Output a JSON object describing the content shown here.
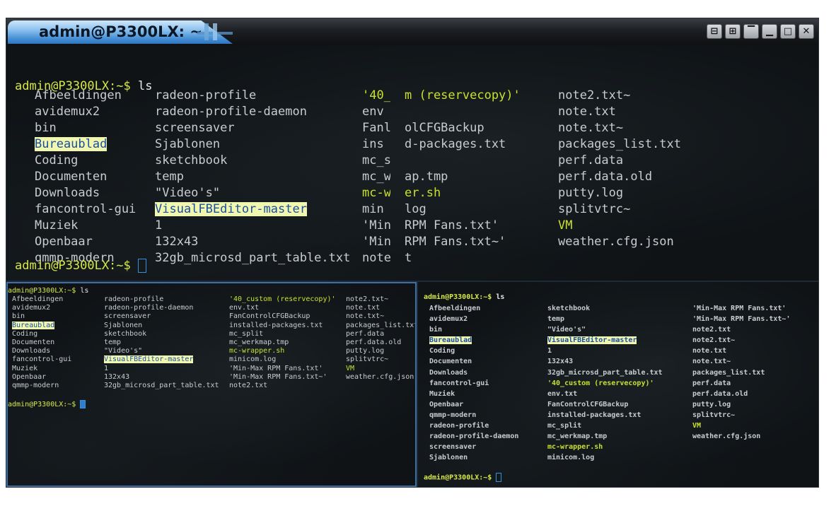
{
  "window": {
    "title": "admin@P3300LX: ~"
  },
  "title_buttons": [
    {
      "name": "tile-horizontal-icon",
      "glyph": "⊟"
    },
    {
      "name": "tile-grid-icon",
      "glyph": "⊞"
    },
    {
      "name": "shade-icon",
      "glyph": "▔"
    },
    {
      "name": "minimize-icon",
      "glyph": "▁"
    },
    {
      "name": "maximize-icon",
      "glyph": "□"
    },
    {
      "name": "close-icon",
      "glyph": "✕"
    }
  ],
  "top_pane": {
    "prompt": "admin@P3300LX:~$",
    "command": "ls",
    "columns": [
      [
        "Afbeeldingen",
        "avidemux2",
        "bin",
        "Bureaublad",
        "Coding",
        "Documenten",
        "Downloads",
        "fancontrol-gui",
        "Muziek",
        "Openbaar",
        "qmmp-modern"
      ],
      [
        "radeon-profile",
        "radeon-profile-daemon",
        "screensaver",
        "Sjablonen",
        "sketchbook",
        "temp",
        "\"Video's\"",
        "VisualFBEditor-master",
        "1",
        "132x43",
        "32gb_microsd_part_table.txt"
      ],
      [
        "'40_c",
        "env",
        "Fanl",
        "ins",
        "mc_s",
        "mc_w",
        "mc-w",
        "min",
        "'Min-",
        "'Min-",
        "note"
      ],
      [
        "m (reservecopy)'",
        "",
        "olCFGBackup",
        "d-packages.txt",
        "",
        "ap.tmp",
        "er.sh",
        "log",
        "RPM Fans.txt'",
        "RPM Fans.txt~'",
        "t"
      ],
      [
        "note2.txt~",
        "note.txt",
        "note.txt~",
        "packages_list.txt",
        "perf.data",
        "perf.data.old",
        "putty.log",
        "splitvtrc~",
        "VM",
        "weather.cfg.json",
        ""
      ]
    ],
    "prompt2": "admin@P3300LX:~$"
  },
  "bottom_left_pane": {
    "prompt": "admin@P3300LX:~$",
    "command": "ls",
    "columns": [
      [
        "Afbeeldingen",
        "avidemux2",
        "bin",
        "Bureaublad",
        "Coding",
        "Documenten",
        "Downloads",
        "fancontrol-gui",
        "Muziek",
        "Openbaar",
        "qmmp-modern"
      ],
      [
        "radeon-profile",
        "radeon-profile-daemon",
        "screensaver",
        "Sjablonen",
        "sketchbook",
        "temp",
        "\"Video's\"",
        "VisualFBEditor-master",
        "1",
        "132x43",
        "32gb_microsd_part_table.txt"
      ],
      [
        "'40_custom (reservecopy)'",
        "env.txt",
        "FanControlCFGBackup",
        "installed-packages.txt",
        "mc_split",
        "mc_werkmap.tmp",
        "mc-wrapper.sh",
        "minicom.log",
        "'Min-Max RPM Fans.txt'",
        "'Min-Max RPM Fans.txt~'",
        "note2.txt"
      ],
      [
        "note2.txt~",
        "note.txt",
        "note.txt~",
        "packages_list.txt",
        "perf.data",
        "perf.data.old",
        "putty.log",
        "splitvtrc~",
        "VM",
        "weather.cfg.json",
        ""
      ]
    ],
    "prompt2": "admin@P3300LX:~$"
  },
  "bottom_right_pane": {
    "prompt": "admin@P3300LX:~$",
    "command": "ls",
    "columns": [
      [
        "Afbeeldingen",
        "avidemux2",
        "bin",
        "Bureaublad",
        "Coding",
        "Documenten",
        "Downloads",
        "fancontrol-gui",
        "Muziek",
        "Openbaar",
        "qmmp-modern",
        "radeon-profile",
        "radeon-profile-daemon",
        "screensaver",
        "Sjablonen"
      ],
      [
        "sketchbook",
        "temp",
        "\"Video's\"",
        "VisualFBEditor-master",
        "1",
        "132x43",
        "32gb_microsd_part_table.txt",
        "'40_custom (reservecopy)'",
        "env.txt",
        "FanControlCFGBackup",
        "installed-packages.txt",
        "mc_split",
        "mc_werkmap.tmp",
        "mc-wrapper.sh",
        "minicom.log"
      ],
      [
        "'Min-Max RPM Fans.txt'",
        "'Min-Max RPM Fans.txt~'",
        "note2.txt",
        "note2.txt~",
        "note.txt",
        "note.txt~",
        "packages_list.txt",
        "perf.data",
        "perf.data.old",
        "putty.log",
        "splitvtrc~",
        "VM",
        "weather.cfg.json",
        "",
        ""
      ]
    ],
    "prompt2": "admin@P3300LX:~$"
  },
  "highlighted": [
    "Bureaublad",
    "VisualFBEditor-master"
  ],
  "executables": [
    "mc-wrapper.sh",
    "mc-w",
    "er.sh",
    "VM",
    "'40_c",
    "m (reservecopy)'",
    "'40_custom (reservecopy)'"
  ],
  "colors": {
    "prompt": "#d6e84a",
    "highlight_bg": "#f2f7b0",
    "highlight_fg": "#1a4ea0",
    "executable": "#c8e030",
    "cursor": "#3b8fd8"
  }
}
